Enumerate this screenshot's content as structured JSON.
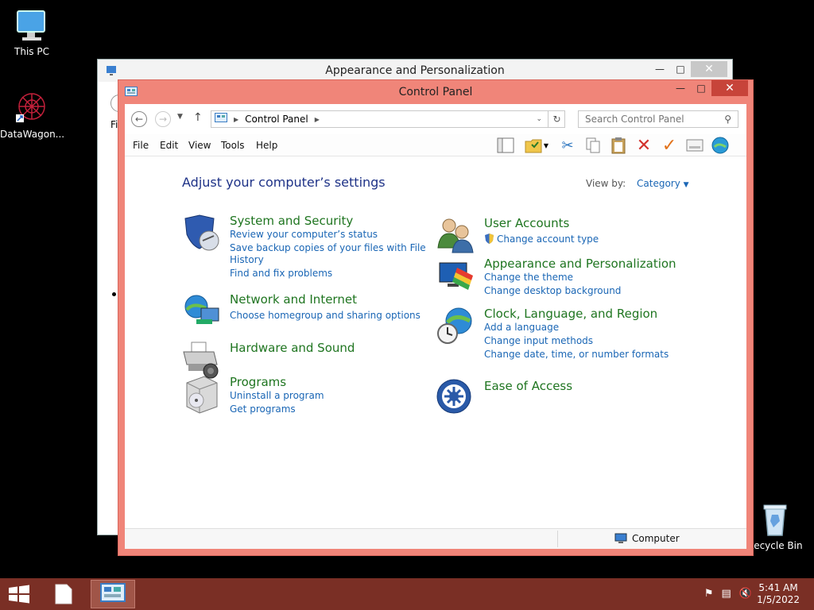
{
  "desktop": {
    "icons": [
      {
        "label": "This PC"
      },
      {
        "label": "DataWagon..."
      },
      {
        "label": "Recycle Bin"
      }
    ]
  },
  "background_window": {
    "title": "Appearance and Personalization",
    "partial_text": "Fi"
  },
  "window": {
    "title": "Control Panel",
    "address": {
      "crumb": "Control Panel"
    },
    "search": {
      "placeholder": "Search Control Panel"
    },
    "menu": [
      "File",
      "Edit",
      "View",
      "Tools",
      "Help"
    ],
    "toolbar_icons": [
      "layout-icon",
      "folder-options-icon",
      "cut-icon",
      "copy-icon",
      "paste-icon",
      "delete-icon",
      "check-icon",
      "properties-icon",
      "globe-icon"
    ]
  },
  "content": {
    "heading": "Adjust your computer’s settings",
    "view_by_label": "View by:",
    "view_by_value": "Category",
    "categories": [
      {
        "title": "System and Security",
        "links": [
          "Review your computer’s status",
          "Save backup copies of your files with File",
          "History",
          "Find and fix problems"
        ]
      },
      {
        "title": "Network and Internet",
        "links": [
          "Choose homegroup and sharing options"
        ]
      },
      {
        "title": "Hardware and Sound",
        "links": []
      },
      {
        "title": "Programs",
        "links": [
          "Uninstall a program",
          "Get programs"
        ]
      },
      {
        "title": "User Accounts",
        "links": [
          "Change account type"
        ]
      },
      {
        "title": "Appearance and Personalization",
        "links": [
          "Change the theme",
          "Change desktop background"
        ]
      },
      {
        "title": "Clock, Language, and Region",
        "links": [
          "Add a language",
          "Change input methods",
          "Change date, time, or number formats"
        ]
      },
      {
        "title": "Ease of Access",
        "links": []
      }
    ]
  },
  "status": {
    "location": "Computer"
  },
  "taskbar": {
    "time": "5:41 AM",
    "date": "1/5/2022"
  },
  "colors": {
    "window_frame": "#f08579",
    "taskbar": "#7a2f25",
    "link": "#1a66b5",
    "category_title": "#1f7520",
    "heading": "#1e3287"
  }
}
